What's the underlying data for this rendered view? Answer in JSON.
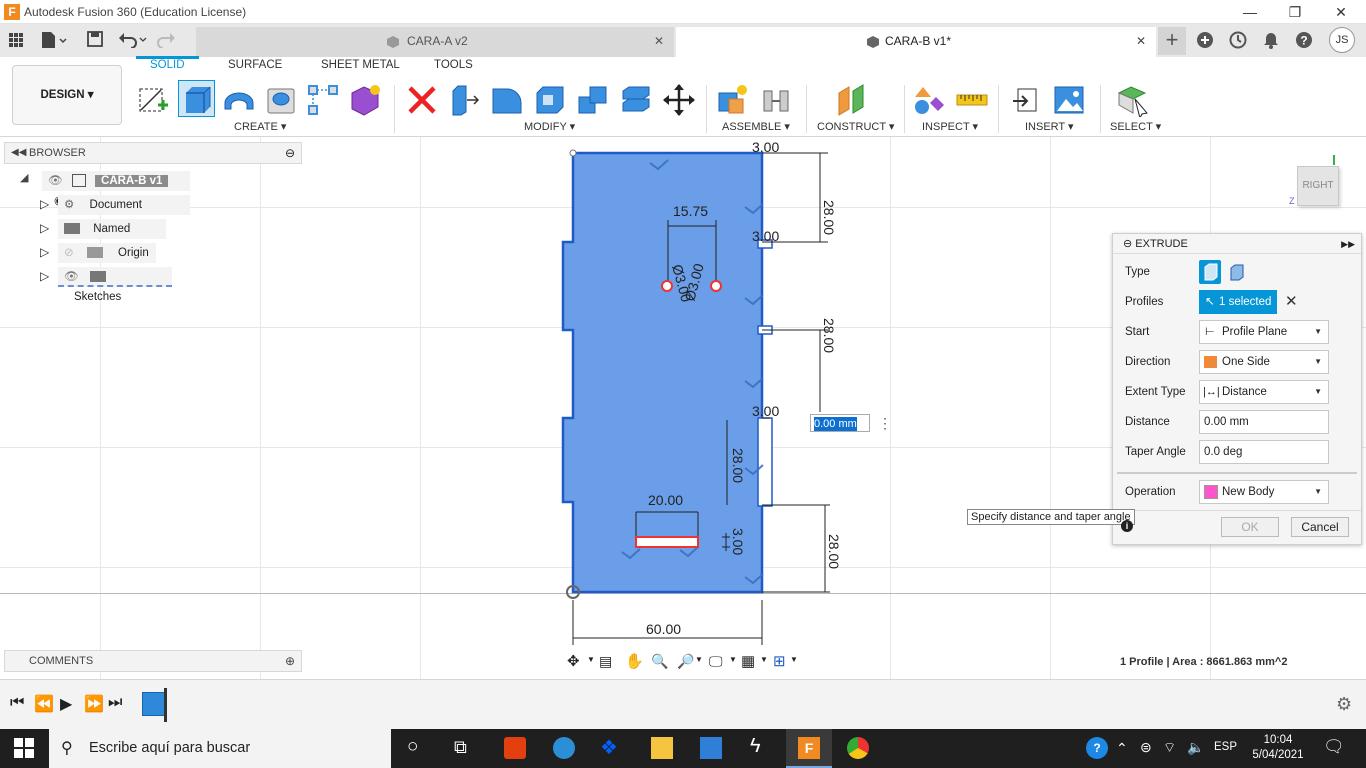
{
  "window": {
    "title": "Autodesk Fusion 360 (Education License)"
  },
  "tabs": [
    {
      "label": "CARA-A v2",
      "active": false
    },
    {
      "label": "CARA-B v1*",
      "active": true
    }
  ],
  "account": {
    "initials": "JS"
  },
  "workspace": {
    "label": "DESIGN"
  },
  "ribbon": {
    "tabs": [
      "SOLID",
      "SURFACE",
      "SHEET METAL",
      "TOOLS"
    ],
    "groups": [
      "CREATE",
      "MODIFY",
      "ASSEMBLE",
      "CONSTRUCT",
      "INSPECT",
      "INSERT",
      "SELECT"
    ]
  },
  "browser": {
    "title": "BROWSER",
    "root": "CARA-B v1",
    "items": [
      "Document Settings",
      "Named Views",
      "Origin",
      "Sketches"
    ]
  },
  "comments": {
    "title": "COMMENTS"
  },
  "viewcube": {
    "face": "RIGHT"
  },
  "sketch": {
    "dims": {
      "d1": "3.00",
      "d2": "28.00",
      "d3": "3.00",
      "d4": "28.00",
      "d5": "3.00",
      "d6": "28.00",
      "d7": "28.00",
      "d8": "15.75",
      "d9": "Ø3.00",
      "d10": "Ø3.00",
      "d11": "20.00",
      "d12": "3.00",
      "d13": "60.00"
    },
    "inline_value": "0.00 mm"
  },
  "extrude": {
    "title": "EXTRUDE",
    "labels": {
      "type": "Type",
      "profiles": "Profiles",
      "start": "Start",
      "direction": "Direction",
      "extent": "Extent Type",
      "distance": "Distance",
      "taper": "Taper Angle",
      "operation": "Operation"
    },
    "values": {
      "profiles": "1 selected",
      "start": "Profile Plane",
      "direction": "One Side",
      "extent": "Distance",
      "distance": "0.00 mm",
      "taper": "0.0 deg",
      "operation": "New Body"
    },
    "ok": "OK",
    "cancel": "Cancel"
  },
  "tooltip": "Specify distance and taper angle",
  "status": "1 Profile | Area : 8661.863 mm^2",
  "taskbar": {
    "search_placeholder": "Escribe aquí para buscar",
    "lang": "ESP",
    "time": "10:04",
    "date": "5/04/2021"
  },
  "colors": {
    "accent": "#0696d7",
    "sketch_fill": "#5b93e6",
    "sketch_edge": "#1f5bc6",
    "taskbar": "#1f1f1f"
  }
}
